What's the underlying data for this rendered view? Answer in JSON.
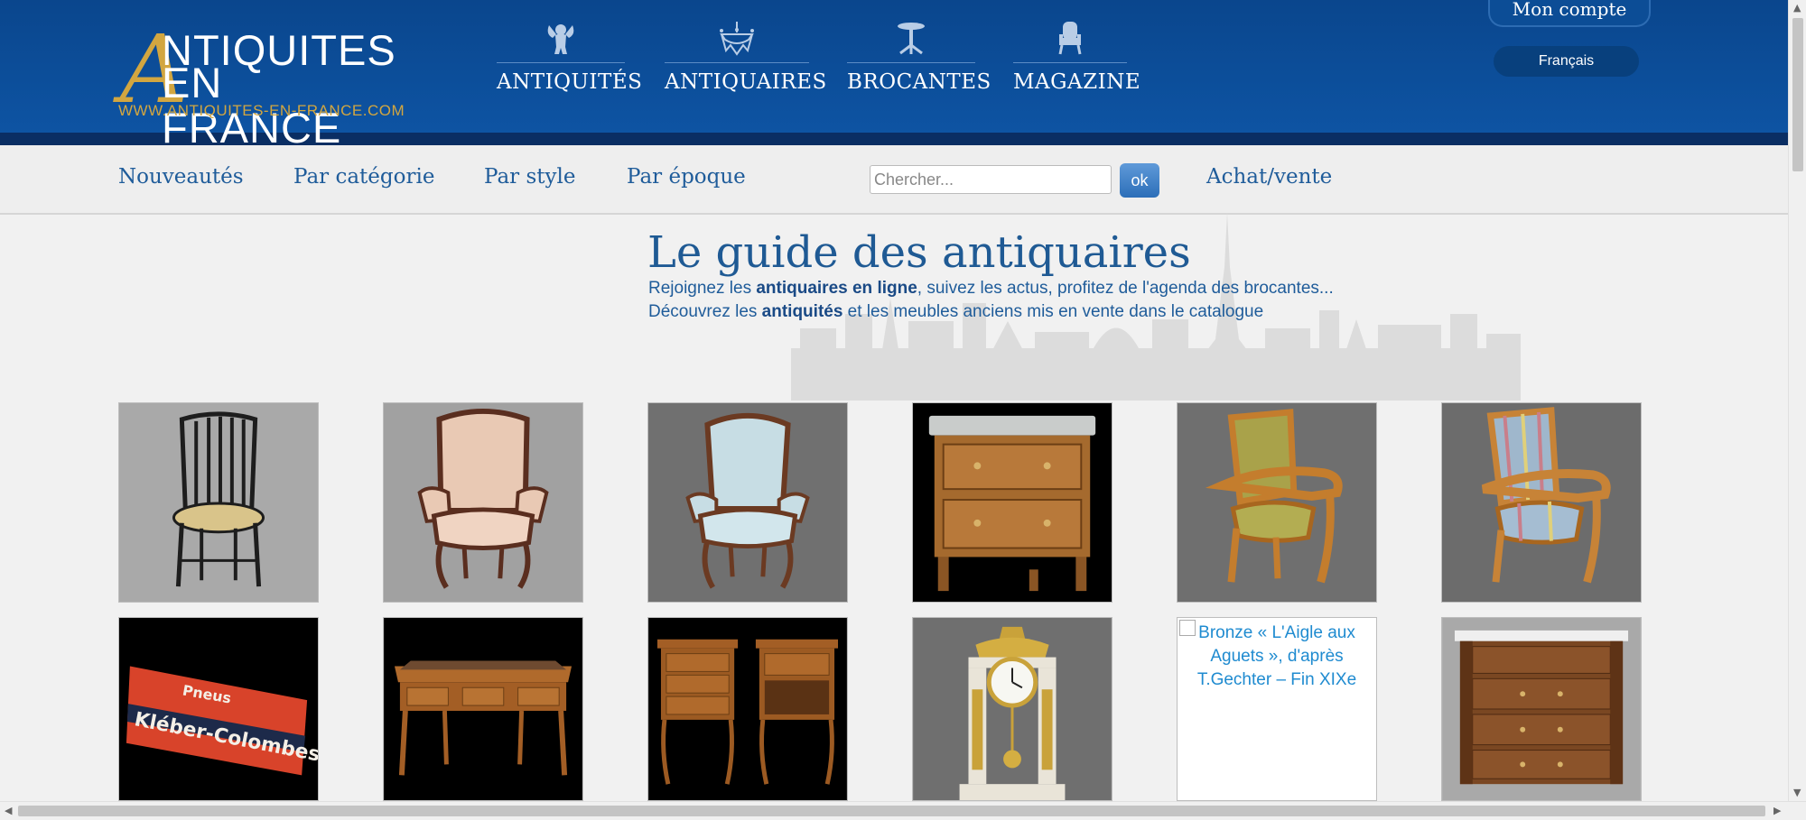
{
  "header": {
    "logo_initial": "A",
    "logo_line1": "NTIQUITES",
    "logo_line2": "EN FRANCE",
    "logo_url": "WWW.ANTIQUITES-EN-FRANCE.COM",
    "nav": [
      {
        "label": "ANTIQUITÉS",
        "icon": "cherub-icon"
      },
      {
        "label": "ANTIQUAIRES",
        "icon": "chandelier-icon"
      },
      {
        "label": "BROCANTES",
        "icon": "pedestal-table-icon"
      },
      {
        "label": "MAGAZINE",
        "icon": "armchair-icon"
      }
    ],
    "account_label": "Mon compte",
    "language": "Français"
  },
  "subnav": {
    "items": [
      "Nouveautés",
      "Par catégorie",
      "Par style",
      "Par époque"
    ],
    "search_placeholder": "Chercher...",
    "search_button": "ok",
    "achat_vente": "Achat/vente"
  },
  "intro": {
    "title": "Le guide des antiquaires",
    "line1_pre": "Rejoignez les ",
    "line1_bold": "antiquaires en ligne",
    "line1_post": ", suivez les actus, profitez de l'agenda des brocantes...",
    "line2_pre": "Découvrez les ",
    "line2_bold": "antiquités",
    "line2_post": " et les meubles anciens mis en vente dans le catalogue"
  },
  "products": [
    {
      "name": "napoleon-iii-chair",
      "bg": "#a8a8a8"
    },
    {
      "name": "louis-xv-armchair",
      "bg": "#a0a0a0"
    },
    {
      "name": "cabriolet-armchair",
      "bg": "#6e6e6e"
    },
    {
      "name": "marble-top-commode",
      "bg": "#000000"
    },
    {
      "name": "restoration-armchair-green",
      "bg": "#6e6e6e"
    },
    {
      "name": "restoration-armchair-striped",
      "bg": "#6a6a6a"
    },
    {
      "name": "kleber-colombes-sign",
      "bg": "#000000"
    },
    {
      "name": "writing-desk",
      "bg": "#000000"
    },
    {
      "name": "pair-of-nightstands",
      "bg": "#000000"
    },
    {
      "name": "portico-clock",
      "bg": "#6e6e6e"
    },
    {
      "name": "broken-bronze-image",
      "bg": "#ffffff",
      "alt": "Bronze « L'Aigle aux Aguets », d'après T.Gechter – Fin XIXe"
    },
    {
      "name": "empire-commode",
      "bg": "#a8a8a8"
    }
  ],
  "sign_text": {
    "top": "Pneus",
    "bottom": "Kléber-Colombes"
  }
}
